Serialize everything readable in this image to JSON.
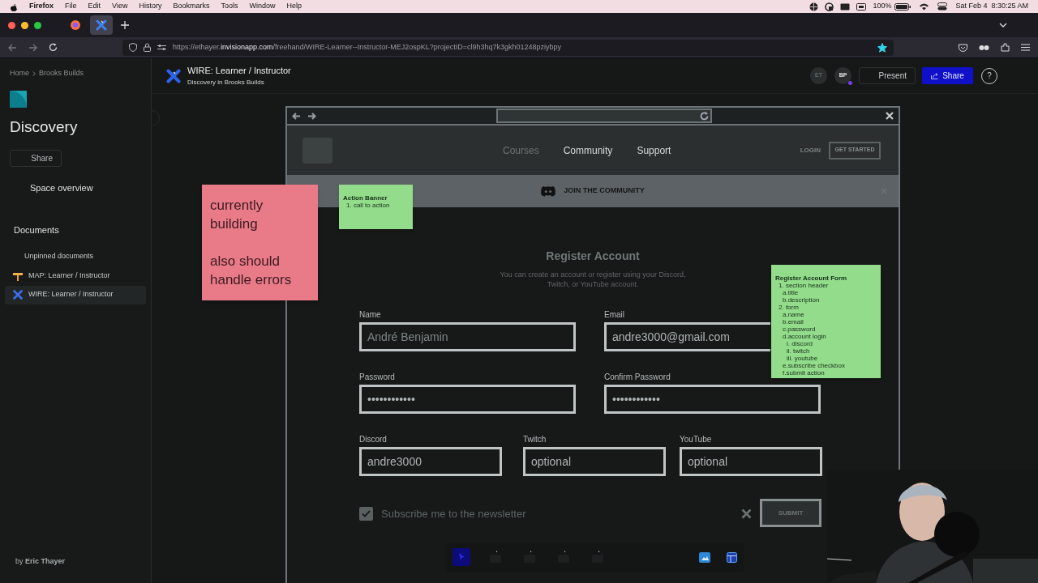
{
  "menu_bar": {
    "app": "Firefox",
    "items": [
      "File",
      "Edit",
      "View",
      "History",
      "Bookmarks",
      "Tools",
      "Window",
      "Help"
    ],
    "battery": "100%",
    "clock": "Sat Feb 4  8:30:25 AM"
  },
  "browser": {
    "tabs": [
      {
        "kind": "firefox",
        "selected": false
      },
      {
        "kind": "invision",
        "selected": true
      }
    ],
    "url_host_prefix": "https://ethayer.",
    "url_host": "invisionapp.com",
    "url_path": "/freehand/WIRE-Learner--Instructor-MEJ2ospKL?projectID=cl9h3hq7k3gkh01248pziybpy",
    "bookmarked": true
  },
  "sidebar": {
    "breadcrumb": [
      "Home",
      "Brooks Builds"
    ],
    "space_title": "Discovery",
    "share_label": "Share",
    "overview_label": "Space overview",
    "documents_heading": "Documents",
    "group_label": "Unpinned documents",
    "documents": [
      {
        "kind": "map",
        "label": "MAP: Learner / Instructor",
        "selected": false
      },
      {
        "kind": "wire",
        "label": "WIRE: Learner / Instructor",
        "selected": true
      }
    ],
    "author": "by **Eric Thayer**"
  },
  "header": {
    "title": "WIRE: Learner / Instructor",
    "subtitle": "Discovery in Brooks Builds",
    "avatars": [
      {
        "initials": "ET",
        "online": false
      },
      {
        "initials": "BP",
        "online": true
      }
    ],
    "present_label": "Present",
    "share_label": "Share",
    "help_label": "?"
  },
  "wireframe": {
    "nav_links": [
      {
        "label": "Courses",
        "muted": true
      },
      {
        "label": "Community",
        "muted": false
      },
      {
        "label": "Support",
        "muted": false
      }
    ],
    "login_label": "LOGIN",
    "get_started_label": "GET STARTED",
    "banner_text": "JOIN THE COMMUNITY",
    "form_title": "Register Account",
    "form_description": "You can create an account or register using your Discord, Twitch, or YouTube account.",
    "field_rows": [
      [
        {
          "label": "Name",
          "placeholder": "André Benjamin"
        },
        {
          "label": "Email",
          "value": "andre3000@gmail.com"
        }
      ],
      [
        {
          "label": "Password",
          "value": "••••••••••••"
        },
        {
          "label": "Confirm Password",
          "value": "••••••••••••"
        }
      ],
      [
        {
          "label": "Discord",
          "value": "andre3000"
        },
        {
          "label": "Twitch",
          "value": "optional"
        },
        {
          "label": "YouTube",
          "value": "optional"
        }
      ]
    ],
    "newsletter": {
      "label": "Subscribe me to the newsletter",
      "checked": true
    },
    "submit_label": "SUBMIT"
  },
  "notes": [
    {
      "kind": "pink",
      "paragraphs": [
        "currently building",
        "also should handle errors"
      ]
    },
    {
      "kind": "green",
      "title": "Action Banner",
      "items": [
        {
          "text": "1. call to action"
        }
      ]
    },
    {
      "kind": "green",
      "title": "Register Account Form",
      "items": [
        {
          "text": "1. section header",
          "children": [
            {
              "text": "a.title"
            },
            {
              "text": "b.description"
            }
          ]
        },
        {
          "text": "2. form",
          "children": [
            {
              "text": "a.name"
            },
            {
              "text": "b.email"
            },
            {
              "text": "c.password"
            },
            {
              "text": "d.account login",
              "children": [
                {
                  "text": "i. discord"
                },
                {
                  "text": "ii. twitch"
                },
                {
                  "text": "iii. youtube"
                }
              ]
            },
            {
              "text": "e.subscribe checkbox"
            },
            {
              "text": "f.submit action"
            }
          ]
        }
      ]
    }
  ]
}
